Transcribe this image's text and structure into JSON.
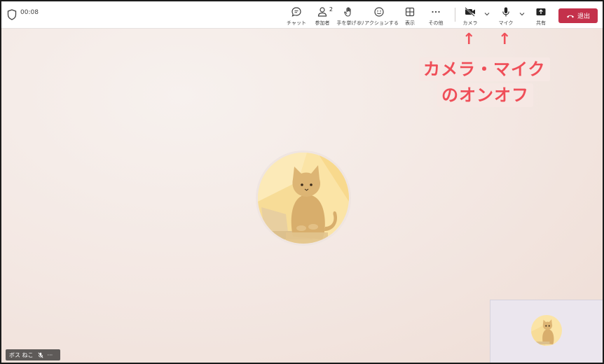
{
  "call": {
    "timer": "00:08"
  },
  "toolbar": {
    "chat_label": "チャット",
    "participants_label": "参加者",
    "participants_count": "2",
    "raise_hand_label": "手を挙げる",
    "reactions_label": "リアクションする",
    "view_label": "表示",
    "more_label": "その他",
    "camera_label": "カメラ",
    "mic_label": "マイク",
    "share_label": "共有",
    "leave_label": "退出"
  },
  "annotation": {
    "arrow": "↑",
    "line1": "カメラ・マイク",
    "line2": "のオンオフ"
  },
  "participant": {
    "name": "ボス ねこ",
    "more": "···"
  },
  "colors": {
    "leave_red": "#c4314b",
    "annotation_red": "#ef4e58"
  }
}
